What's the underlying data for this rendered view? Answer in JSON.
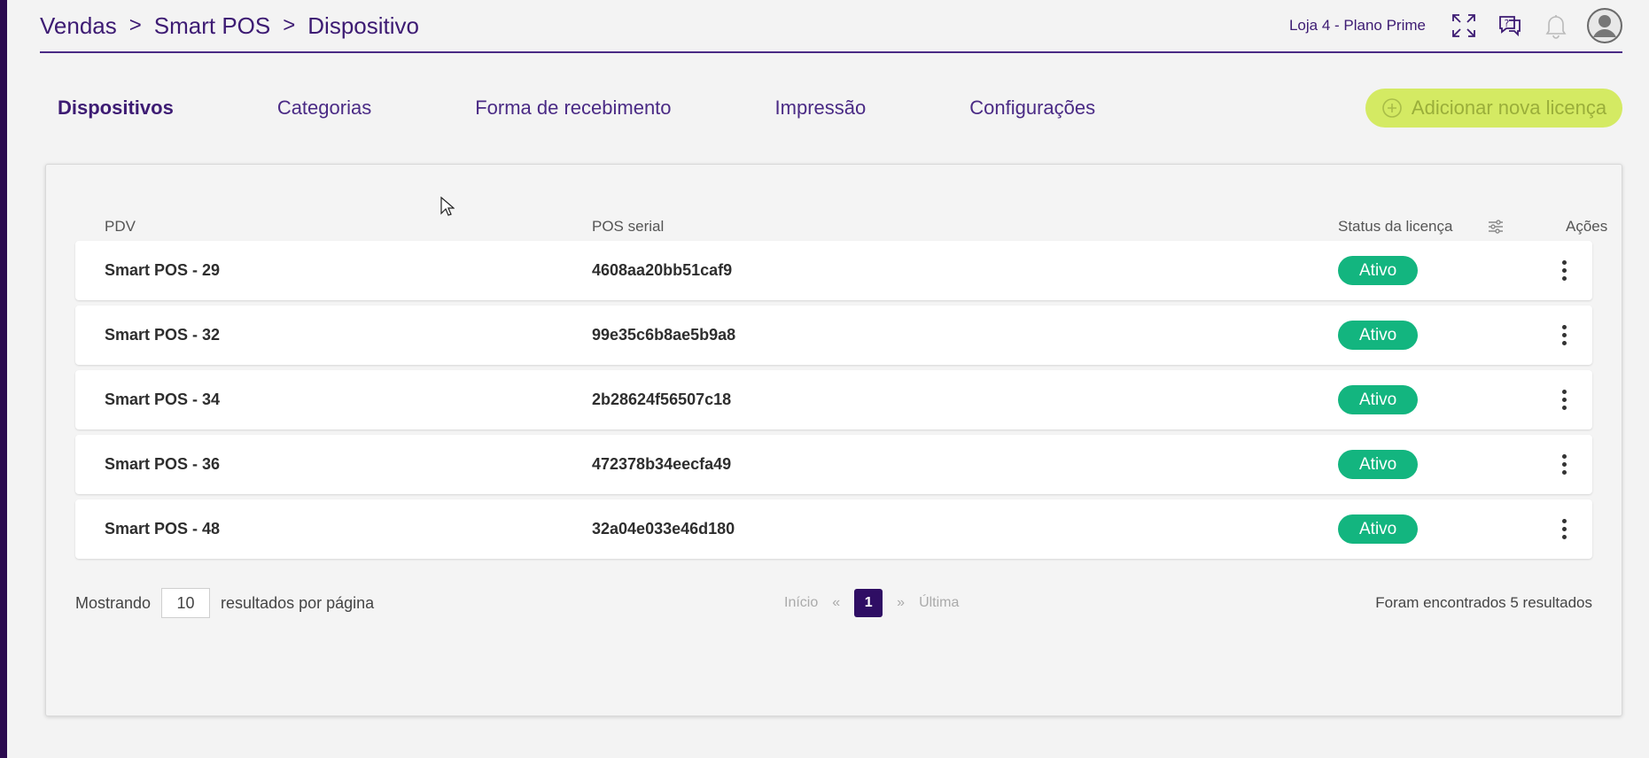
{
  "breadcrumb": {
    "items": [
      "Vendas",
      "Smart POS",
      "Dispositivo"
    ],
    "separator": ">"
  },
  "header": {
    "store_label": "Loja 4 - Plano Prime",
    "icons": [
      "expand-icon",
      "help-chat-icon",
      "bell-icon",
      "user-avatar-icon"
    ]
  },
  "tabs": [
    {
      "label": "Dispositivos",
      "active": true
    },
    {
      "label": "Categorias",
      "active": false
    },
    {
      "label": "Forma de recebimento",
      "active": false
    },
    {
      "label": "Impressão",
      "active": false
    },
    {
      "label": "Configurações",
      "active": false
    }
  ],
  "add_button": {
    "label": "Adicionar nova licença",
    "icon": "plus-circle-icon"
  },
  "table": {
    "headers": {
      "pdv": "PDV",
      "serial": "POS serial",
      "status": "Status da licença",
      "actions": "Ações"
    },
    "rows": [
      {
        "pdv": "Smart POS - 29",
        "serial": "4608aa20bb51caf9",
        "status": "Ativo"
      },
      {
        "pdv": "Smart POS - 32",
        "serial": "99e35c6b8ae5b9a8",
        "status": "Ativo"
      },
      {
        "pdv": "Smart POS - 34",
        "serial": "2b28624f56507c18",
        "status": "Ativo"
      },
      {
        "pdv": "Smart POS - 36",
        "serial": "472378b34eecfa49",
        "status": "Ativo"
      },
      {
        "pdv": "Smart POS - 48",
        "serial": "32a04e033e46d180",
        "status": "Ativo"
      }
    ]
  },
  "footer": {
    "showing_label": "Mostrando",
    "per_page_value": "10",
    "per_page_suffix": "resultados por página",
    "pager": {
      "first": "Início",
      "prev": "«",
      "current": "1",
      "next": "»",
      "last": "Última"
    },
    "results_text": "Foram encontrados 5 resultados"
  },
  "colors": {
    "brand_purple": "#3d1b73",
    "active_badge": "#13b57f",
    "add_button_bg": "#d4ea63",
    "pager_current_bg": "#2f0e64"
  }
}
